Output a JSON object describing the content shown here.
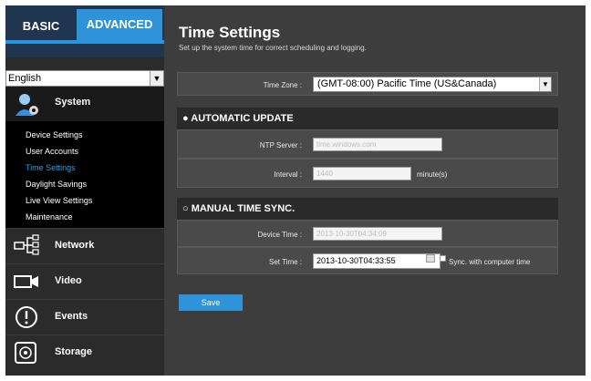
{
  "tabs": {
    "basic": "BASIC",
    "advanced": "ADVANCED"
  },
  "language": {
    "selected": "English"
  },
  "sidebar": {
    "system": {
      "label": "System",
      "items": [
        "Device Settings",
        "User Accounts",
        "Time Settings",
        "Daylight Savings",
        "Live View Settings",
        "Maintenance"
      ],
      "active": "Time Settings"
    },
    "categories": [
      {
        "label": "Network",
        "icon": "network-icon"
      },
      {
        "label": "Video",
        "icon": "video-camera-icon"
      },
      {
        "label": "Events",
        "icon": "alert-icon"
      },
      {
        "label": "Storage",
        "icon": "storage-icon"
      }
    ]
  },
  "page": {
    "title": "Time Settings",
    "subtitle": "Set up the system time for correct scheduling and logging."
  },
  "timezone": {
    "label": "Time Zone :",
    "value": "(GMT-08:00) Pacific Time (US&Canada)"
  },
  "auto": {
    "header": "● AUTOMATIC UPDATE",
    "ntp_label": "NTP Server :",
    "ntp_value": "time.windows.com",
    "interval_label": "Interval :",
    "interval_value": "1440",
    "interval_unit": "minute(s)"
  },
  "manual": {
    "header": "○ MANUAL TIME SYNC.",
    "device_label": "Device Time :",
    "device_value": "2013-10-30T04:34:09",
    "set_label": "Set Time :",
    "set_value": "2013-10-30T04:33:55",
    "sync_label": "Sync. with computer time"
  },
  "save_label": "Save",
  "colors": {
    "accent": "#2f93d9",
    "panel": "#3d3d3d",
    "sidebar": "#2b2b2b"
  }
}
